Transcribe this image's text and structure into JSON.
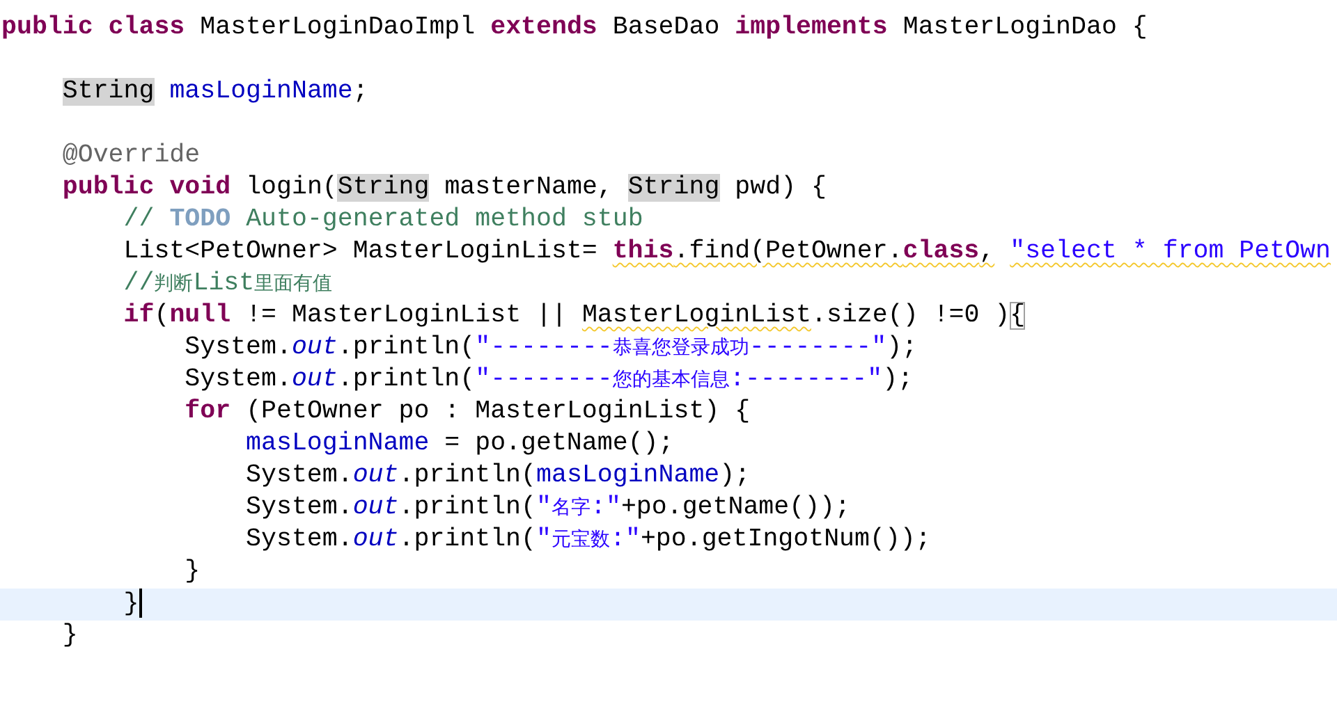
{
  "editor": {
    "lines": [
      {
        "current": false,
        "tokens": [
          {
            "kind": "keyword",
            "text": "public "
          },
          {
            "kind": "keyword",
            "text": "class"
          },
          {
            "kind": "plain",
            "text": " MasterLoginDaoImpl "
          },
          {
            "kind": "keyword",
            "text": "extends"
          },
          {
            "kind": "plain",
            "text": " BaseDao "
          },
          {
            "kind": "keyword",
            "text": "implements"
          },
          {
            "kind": "plain",
            "text": " MasterLoginDao {"
          }
        ]
      },
      {
        "current": false
      },
      {
        "current": false,
        "tokens": [
          {
            "kind": "plain",
            "text": "    String",
            "occurrence": true
          },
          {
            "kind": "field",
            "text": " masLoginName"
          },
          {
            "kind": "plain",
            "text": ";"
          }
        ]
      },
      {
        "current": false
      },
      {
        "current": false,
        "tokens": [
          {
            "kind": "annotation",
            "text": "    @Override"
          }
        ]
      },
      {
        "current": false,
        "tokens": [
          {
            "kind": "keyword",
            "text": "    public "
          },
          {
            "kind": "keyword",
            "text": "void"
          },
          {
            "kind": "plain",
            "text": " login("
          },
          {
            "kind": "plain",
            "text": "String",
            "occurrence": true
          },
          {
            "kind": "plain",
            "text": " masterName, "
          },
          {
            "kind": "plain",
            "text": "String",
            "occurrence": true
          },
          {
            "kind": "plain",
            "text": " pwd) {"
          }
        ]
      },
      {
        "current": false,
        "tokens": [
          {
            "kind": "comment",
            "text": "        // "
          },
          {
            "kind": "todo",
            "text": "TODO"
          },
          {
            "kind": "comment",
            "text": " Auto-generated method stub"
          }
        ]
      },
      {
        "current": false,
        "tokens": [
          {
            "kind": "plain",
            "text": "        List<PetOwner> MasterLoginList= "
          },
          {
            "kind": "keyword",
            "text": "this",
            "warning": true
          },
          {
            "kind": "plain",
            "text": ".find(PetOwner.",
            "warning": true
          },
          {
            "kind": "keyword",
            "text": "class",
            "warning": true
          },
          {
            "kind": "plain",
            "text": ",",
            "warning": true
          },
          {
            "kind": "string",
            "text": " \"select * from PetOwn",
            "warning": true
          }
        ]
      },
      {
        "current": false,
        "tokens": [
          {
            "kind": "comment",
            "text": "        //判断List里面有值"
          }
        ]
      },
      {
        "current": false,
        "tokens": [
          {
            "kind": "keyword",
            "text": "        if"
          },
          {
            "kind": "plain",
            "text": "("
          },
          {
            "kind": "keyword",
            "text": "null"
          },
          {
            "kind": "plain",
            "text": " != MasterLoginList || "
          },
          {
            "kind": "plain",
            "text": "MasterLoginList",
            "warning": true
          },
          {
            "kind": "plain",
            "text": ".size() !=0 )"
          },
          {
            "kind": "plain",
            "text": "{",
            "matched": true
          }
        ]
      },
      {
        "current": false,
        "tokens": [
          {
            "kind": "plain",
            "text": "            System."
          },
          {
            "kind": "static",
            "text": "out"
          },
          {
            "kind": "plain",
            "text": ".println("
          },
          {
            "kind": "string",
            "text": "\"--------恭喜您登录成功--------\""
          },
          {
            "kind": "plain",
            "text": ");"
          }
        ]
      },
      {
        "current": false,
        "tokens": [
          {
            "kind": "plain",
            "text": "            System."
          },
          {
            "kind": "static",
            "text": "out"
          },
          {
            "kind": "plain",
            "text": ".println("
          },
          {
            "kind": "string",
            "text": "\"--------您的基本信息:--------\""
          },
          {
            "kind": "plain",
            "text": ");"
          }
        ]
      },
      {
        "current": false,
        "tokens": [
          {
            "kind": "keyword",
            "text": "            for"
          },
          {
            "kind": "plain",
            "text": " (PetOwner po : MasterLoginList) {"
          }
        ]
      },
      {
        "current": false,
        "tokens": [
          {
            "kind": "field",
            "text": "                masLoginName"
          },
          {
            "kind": "plain",
            "text": " = po.getName();"
          }
        ]
      },
      {
        "current": false,
        "tokens": [
          {
            "kind": "plain",
            "text": "                System."
          },
          {
            "kind": "static",
            "text": "out"
          },
          {
            "kind": "plain",
            "text": ".println("
          },
          {
            "kind": "field",
            "text": "masLoginName"
          },
          {
            "kind": "plain",
            "text": ");"
          }
        ]
      },
      {
        "current": false,
        "tokens": [
          {
            "kind": "plain",
            "text": "                System."
          },
          {
            "kind": "static",
            "text": "out"
          },
          {
            "kind": "plain",
            "text": ".println("
          },
          {
            "kind": "string",
            "text": "\"名字:\""
          },
          {
            "kind": "plain",
            "text": "+po.getName());"
          }
        ]
      },
      {
        "current": false,
        "tokens": [
          {
            "kind": "plain",
            "text": "                System."
          },
          {
            "kind": "static",
            "text": "out"
          },
          {
            "kind": "plain",
            "text": ".println("
          },
          {
            "kind": "string",
            "text": "\"元宝数:\""
          },
          {
            "kind": "plain",
            "text": "+po.getIngotNum());"
          }
        ]
      },
      {
        "current": false,
        "tokens": [
          {
            "kind": "plain",
            "text": "            }"
          }
        ]
      },
      {
        "current": true,
        "caret": true,
        "tokens": [
          {
            "kind": "plain",
            "text": "        }"
          }
        ]
      },
      {
        "current": false,
        "tokens": [
          {
            "kind": "plain",
            "text": "    }"
          }
        ]
      }
    ]
  }
}
